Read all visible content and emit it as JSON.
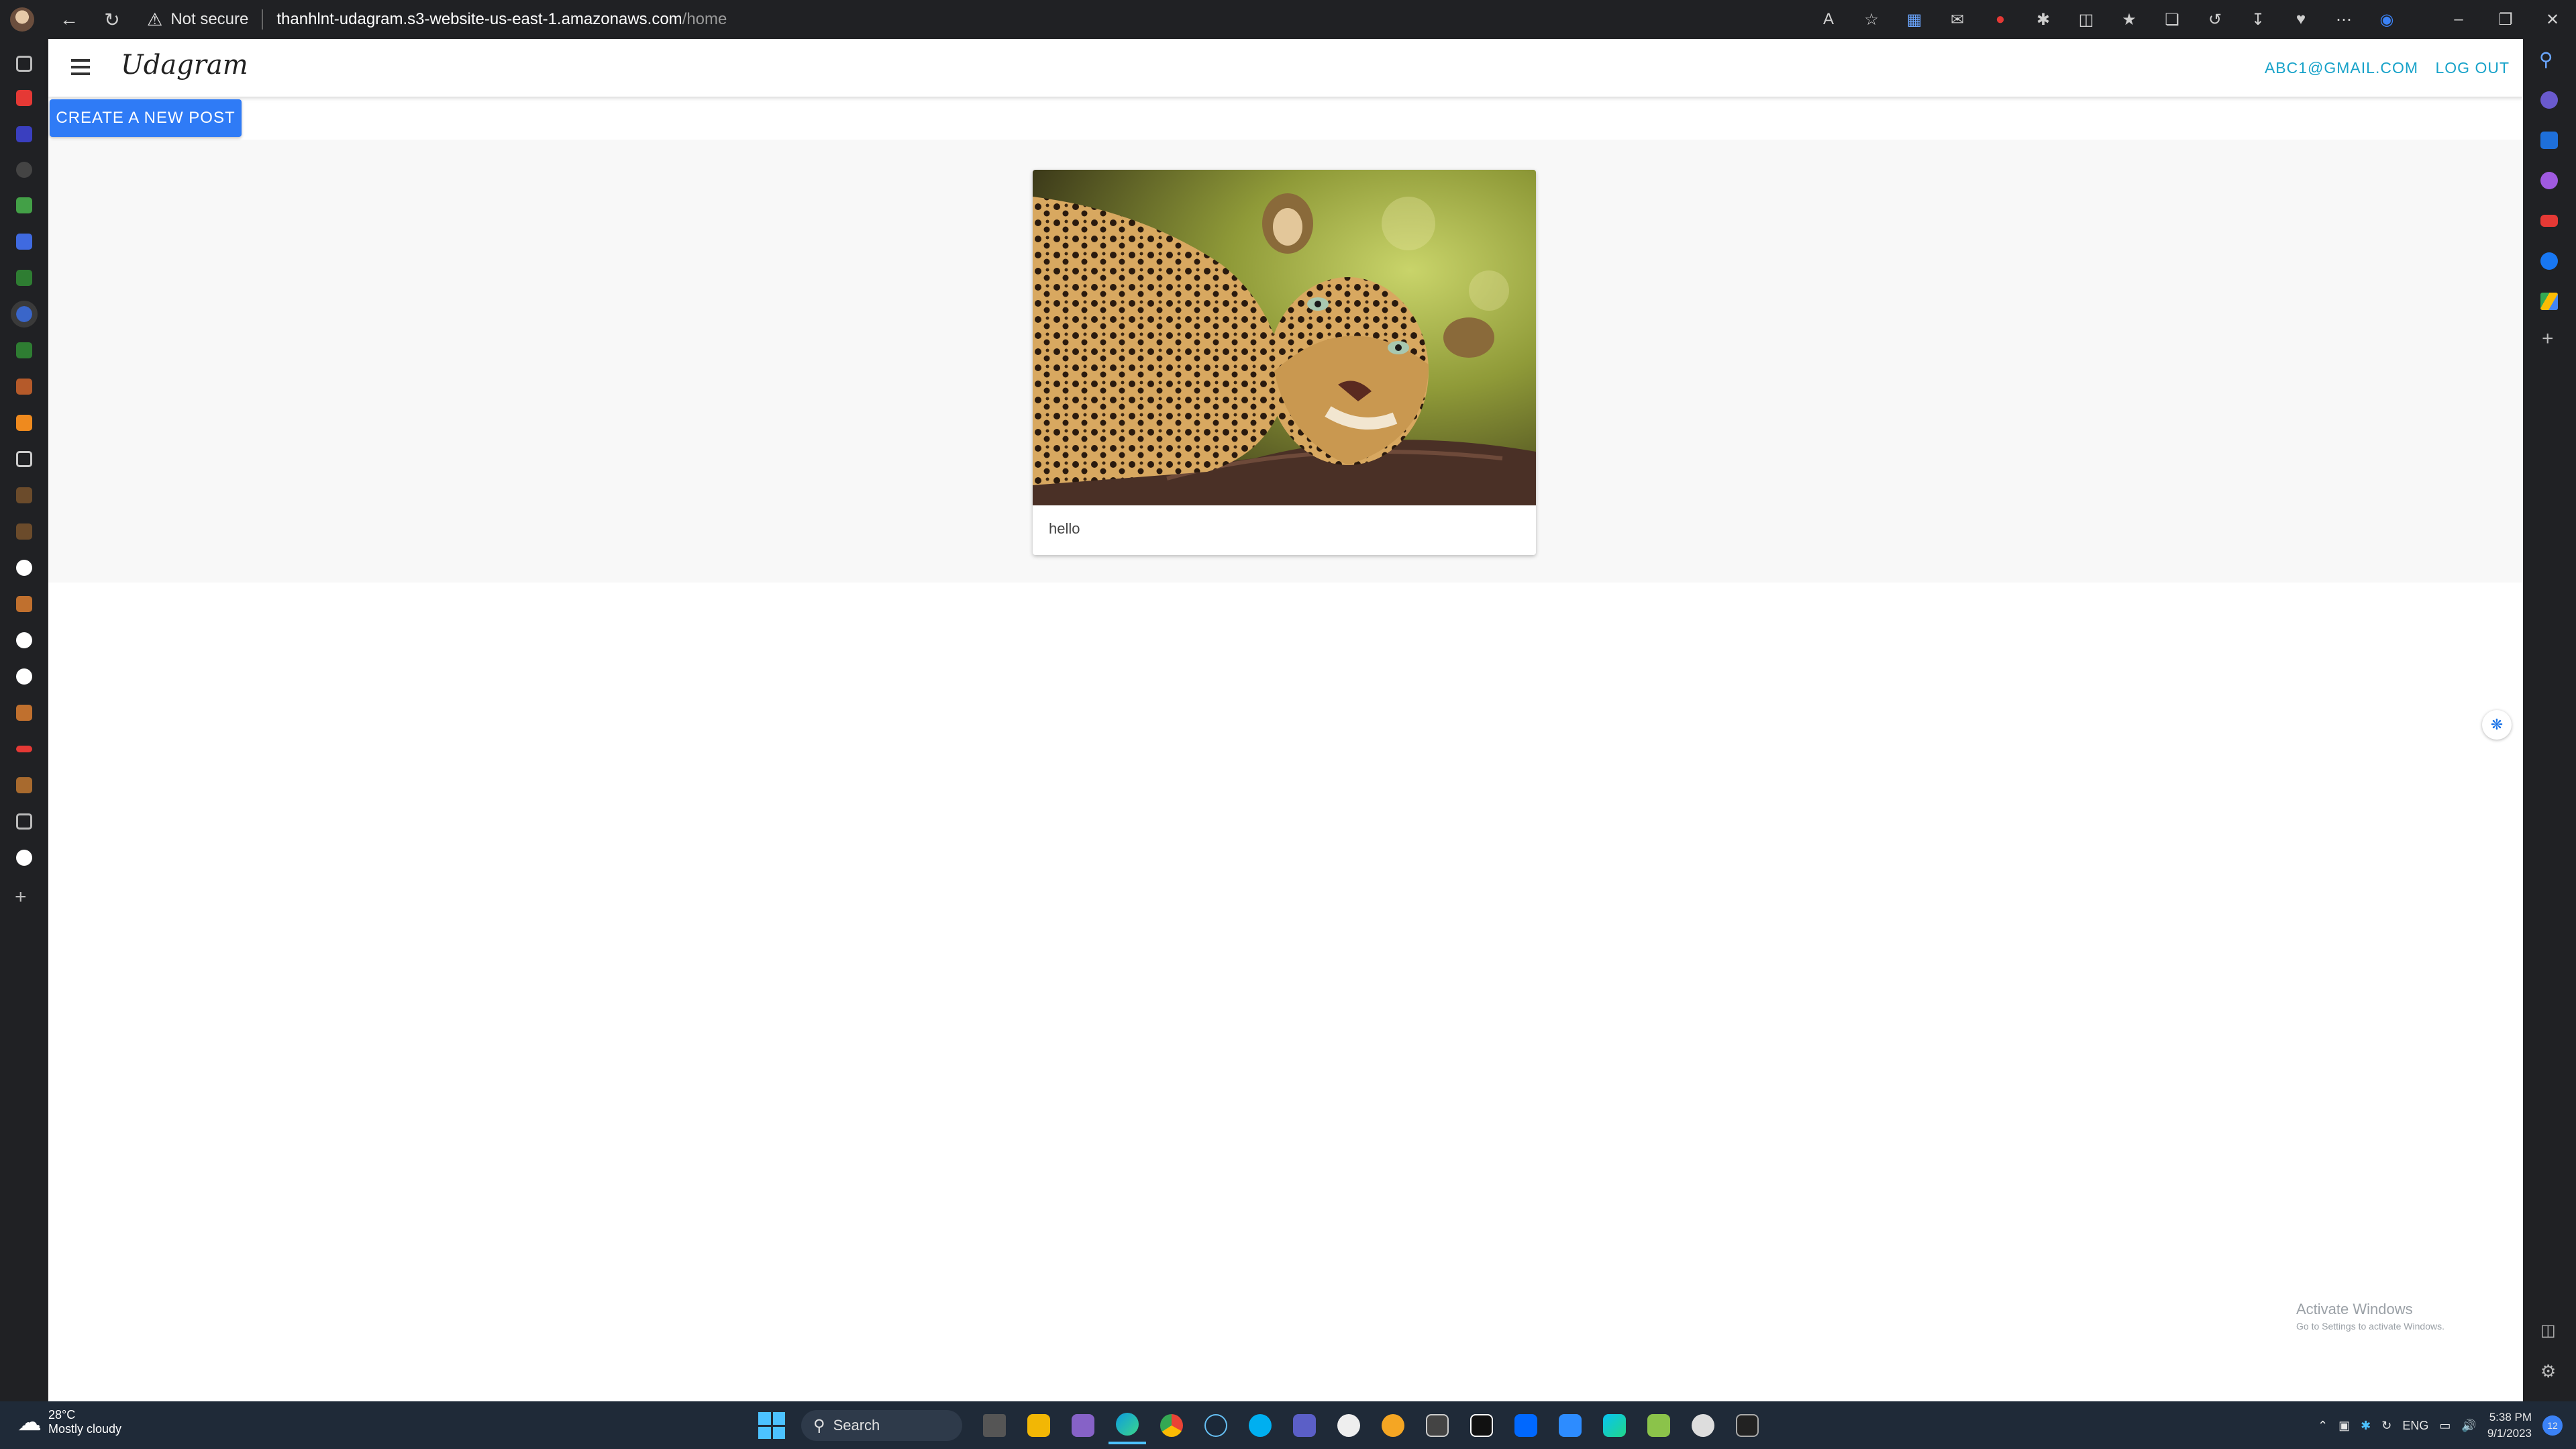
{
  "browser": {
    "security_label": "Not secure",
    "url_host": "thanhlnt-udagram.s3-website-us-east-1.amazonaws.com",
    "url_path": "/home"
  },
  "app": {
    "brand": "Udagram",
    "user_email": "ABC1@GMAIL.COM",
    "logout_label": "LOG OUT",
    "create_post_label": "CREATE A NEW POST"
  },
  "feed": {
    "posts": [
      {
        "caption": "hello",
        "image_subject": "leopard resting on a branch"
      }
    ]
  },
  "watermark": {
    "title": "Activate Windows",
    "subtitle": "Go to Settings to activate Windows."
  },
  "taskbar": {
    "weather_temp": "28°C",
    "weather_cond": "Mostly cloudy",
    "search_label": "Search",
    "lang": "ENG",
    "time": "5:38 PM",
    "date": "9/1/2023",
    "notification_count": "12"
  },
  "colors": {
    "accent_link": "#17a2c9",
    "primary_button": "#2f7bf6"
  }
}
